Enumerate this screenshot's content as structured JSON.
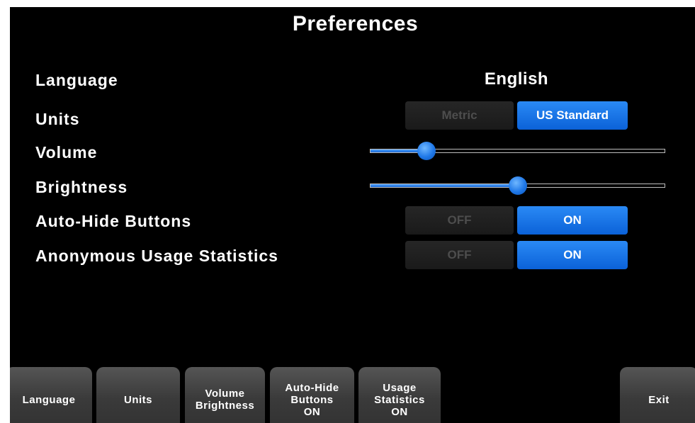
{
  "title": "Preferences",
  "rows": {
    "language": {
      "label": "Language",
      "value": "English"
    },
    "units": {
      "label": "Units",
      "options": [
        "Metric",
        "US Standard"
      ],
      "selected": "US Standard"
    },
    "volume": {
      "label": "Volume",
      "level": 0.19
    },
    "brightness": {
      "label": "Brightness",
      "level": 0.5
    },
    "auto_hide": {
      "label": "Auto-Hide Buttons",
      "off": "OFF",
      "on": "ON",
      "selected": "ON"
    },
    "usage_stats": {
      "label": "Anonymous Usage Statistics",
      "off": "OFF",
      "on": "ON",
      "selected": "ON"
    }
  },
  "softkeys": {
    "language": "Language",
    "units": "Units",
    "volume_brightness": [
      "Volume",
      "Brightness"
    ],
    "auto_hide": [
      "Auto-Hide",
      "Buttons",
      "ON"
    ],
    "usage_stats": [
      "Usage",
      "Statistics",
      "ON"
    ],
    "exit": "Exit"
  },
  "colors": {
    "background": "#000000",
    "accent": "#1a73e8",
    "inactive_toggle": "#222222",
    "softkey": "#444444"
  }
}
